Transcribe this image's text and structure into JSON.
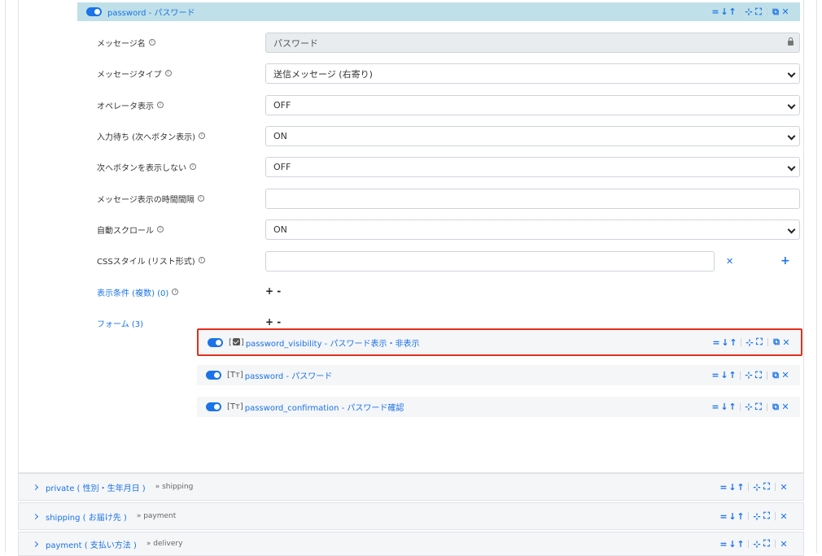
{
  "header": {
    "title": "password - パスワード",
    "actions": [
      "=",
      "↓",
      "↑",
      "⊹",
      "⛶",
      "⧉",
      "✕"
    ]
  },
  "fields": [
    {
      "label": "メッセージ名",
      "value": "パスワード",
      "kind": "text-locked"
    },
    {
      "label": "メッセージタイプ",
      "value": "送信メッセージ (右寄り)",
      "kind": "select"
    },
    {
      "label": "オペレータ表示",
      "value": "OFF",
      "kind": "select"
    },
    {
      "label": "入力待ち (次へボタン表示)",
      "value": "ON",
      "kind": "select"
    },
    {
      "label": "次へボタンを表示しない",
      "value": "OFF",
      "kind": "select"
    },
    {
      "label": "メッセージ表示の時間間隔",
      "value": "",
      "kind": "text"
    },
    {
      "label": "自動スクロール",
      "value": "ON",
      "kind": "select"
    },
    {
      "label": "CSSスタイル (リスト形式)",
      "value": "",
      "kind": "text-list"
    }
  ],
  "css_list": {
    "remove": "✕",
    "add": "+"
  },
  "conditions": {
    "label": "表示条件 (複数) (0)",
    "controls": "+ -"
  },
  "forms": {
    "label": "フォーム (3)",
    "controls": "+ -",
    "items": [
      {
        "type_tag": "[",
        "type_tag_end": "]",
        "icon": "checkbox-icon",
        "title": "password_visibility - パスワード表示・非表示",
        "selected": true
      },
      {
        "type_tag": "[Tт]",
        "icon": "text-type-icon",
        "title": "password - パスワード",
        "selected": false
      },
      {
        "type_tag": "[Tт]",
        "icon": "text-type-icon",
        "title": "password_confirmation - パスワード確認",
        "selected": false
      }
    ]
  },
  "sections": [
    {
      "name": "private ( 性別・生年月日 )",
      "next": "» shipping"
    },
    {
      "name": "shipping ( お届け先 )",
      "next": "» payment"
    },
    {
      "name": "payment ( 支払い方法 )",
      "next": "» delivery"
    }
  ],
  "colors": {
    "accent": "#1a73e8",
    "highlight": "#e0301e",
    "header_bg": "#bfe0e8"
  }
}
